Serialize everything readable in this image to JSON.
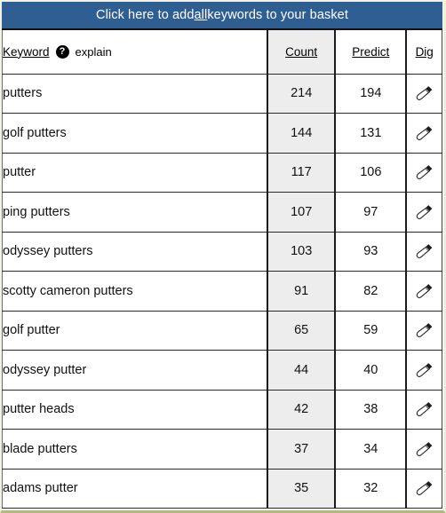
{
  "banner": {
    "prefix": "Click here to add ",
    "emphasis": "all",
    "suffix": " keywords to your basket",
    "color": "#2f5f92",
    "text_color": "#ffffff"
  },
  "table": {
    "columns": {
      "keyword": "Keyword",
      "explain": "explain",
      "explain_icon": "question-mark-icon",
      "count": "Count",
      "predict": "Predict",
      "dig": "Dig"
    },
    "count_column_highlight": "#ededed",
    "dig_icon": "trowel-icon",
    "rows": [
      {
        "keyword": "putters",
        "count": "214",
        "predict": "194"
      },
      {
        "keyword": "golf putters",
        "count": "144",
        "predict": "131"
      },
      {
        "keyword": "putter",
        "count": "117",
        "predict": "106"
      },
      {
        "keyword": "ping putters",
        "count": "107",
        "predict": "97"
      },
      {
        "keyword": "odyssey putters",
        "count": "103",
        "predict": "93"
      },
      {
        "keyword": "scotty cameron putters",
        "count": "91",
        "predict": "82"
      },
      {
        "keyword": "golf putter",
        "count": "65",
        "predict": "59"
      },
      {
        "keyword": "odyssey putter",
        "count": "44",
        "predict": "40"
      },
      {
        "keyword": "putter heads",
        "count": "42",
        "predict": "38"
      },
      {
        "keyword": "blade putters",
        "count": "37",
        "predict": "34"
      },
      {
        "keyword": "adams putter",
        "count": "35",
        "predict": "32"
      }
    ]
  },
  "chart_data": {
    "type": "table",
    "title": "Keyword Count and Predict",
    "categories": [
      "putters",
      "golf putters",
      "putter",
      "ping putters",
      "odyssey putters",
      "scotty cameron putters",
      "golf putter",
      "odyssey putter",
      "putter heads",
      "blade putters",
      "adams putter"
    ],
    "series": [
      {
        "name": "Count",
        "values": [
          214,
          144,
          117,
          107,
          103,
          91,
          65,
          44,
          42,
          37,
          35
        ]
      },
      {
        "name": "Predict",
        "values": [
          194,
          131,
          106,
          97,
          93,
          82,
          59,
          40,
          38,
          34,
          32
        ]
      }
    ]
  }
}
